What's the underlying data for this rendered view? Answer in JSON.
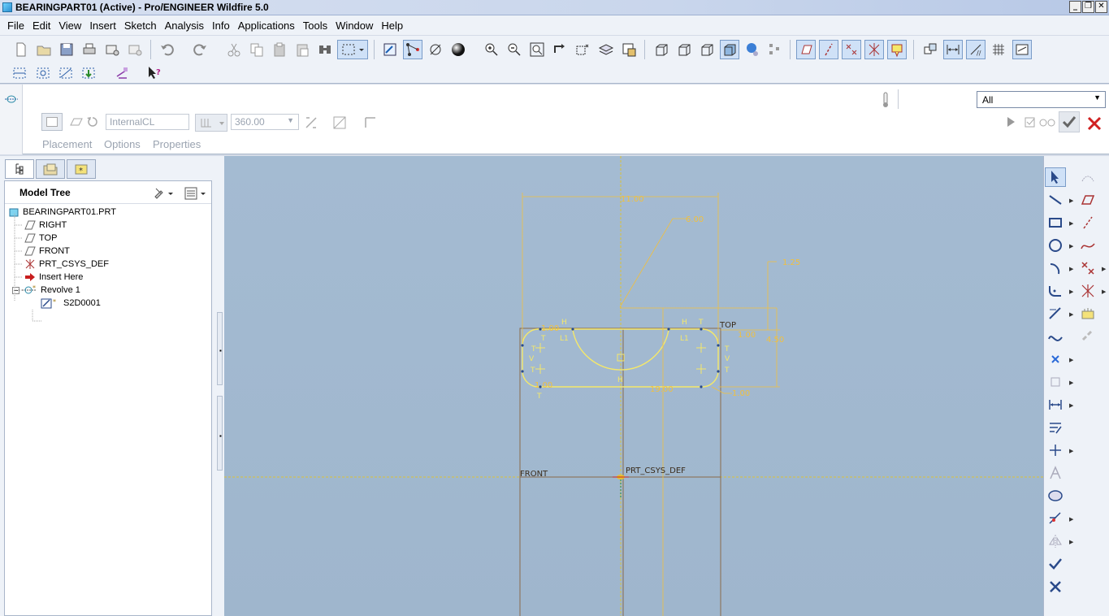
{
  "window": {
    "title": "BEARINGPART01 (Active) - Pro/ENGINEER Wildfire 5.0"
  },
  "menu": [
    "File",
    "Edit",
    "View",
    "Insert",
    "Sketch",
    "Analysis",
    "Info",
    "Applications",
    "Tools",
    "Window",
    "Help"
  ],
  "dashboard": {
    "axis_field": "InternalCL",
    "angle_value": "360.00",
    "tabs": [
      "Placement",
      "Options",
      "Properties"
    ],
    "filter": "All"
  },
  "model_tree": {
    "title": "Model Tree",
    "items": [
      {
        "label": "BEARINGPART01.PRT",
        "icon": "part-icon"
      },
      {
        "label": "RIGHT",
        "icon": "datum-plane-icon"
      },
      {
        "label": "TOP",
        "icon": "datum-plane-icon"
      },
      {
        "label": "FRONT",
        "icon": "datum-plane-icon"
      },
      {
        "label": "PRT_CSYS_DEF",
        "icon": "csys-icon"
      },
      {
        "label": "Insert Here",
        "icon": "insert-arrow-icon"
      },
      {
        "label": "Revolve 1",
        "icon": "revolve-icon"
      },
      {
        "label": "S2D0001",
        "icon": "sketch-icon"
      }
    ]
  },
  "sketch": {
    "dimensions": [
      "11.00",
      "6.00",
      "1.25",
      "1.00",
      "1.00",
      "4.50",
      "1.00",
      "19.00",
      "1.00"
    ],
    "labels": [
      "TOP",
      "FRONT",
      "PRT_CSYS_DEF"
    ],
    "constraints": [
      "H",
      "H",
      "T",
      "L1",
      "L1",
      "T",
      "V",
      "T",
      "T",
      "V",
      "T",
      "T",
      "T",
      "H"
    ],
    "colors": {
      "background": "#a4bbd2",
      "sketch": "#f5e86a",
      "dimension": "#f0c040",
      "datum": "#8a6a4a"
    }
  }
}
